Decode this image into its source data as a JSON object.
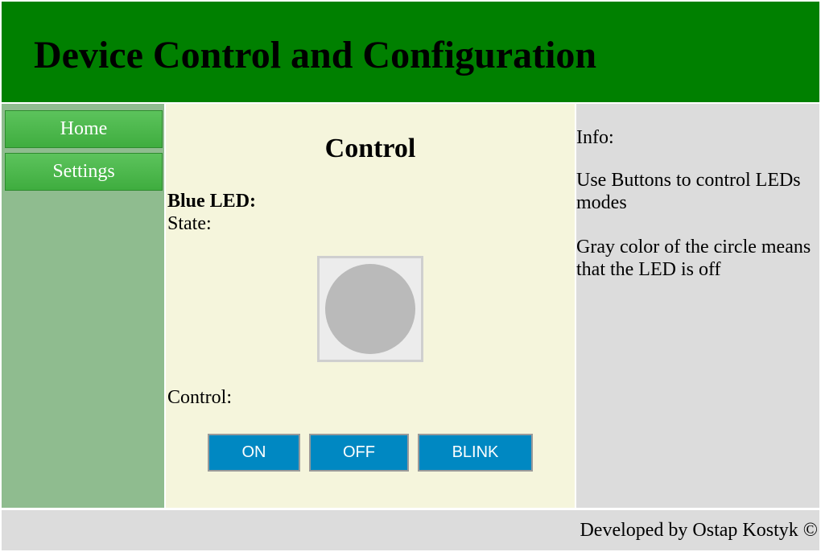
{
  "header": {
    "title": "Device Control and Configuration"
  },
  "colors": {
    "header_bg": "#008000",
    "sidebar_bg": "#8fbc8f",
    "main_bg": "#f5f5dc",
    "info_bg": "#dcdcdc",
    "button_bg": "#0088c2",
    "led_off": "#bababa"
  },
  "sidebar": {
    "items": [
      {
        "label": "Home"
      },
      {
        "label": "Settings"
      }
    ]
  },
  "main": {
    "title": "Control",
    "led_label": "Blue LED:",
    "state_label": "State:",
    "led_state_icon": "led-indicator-circle",
    "control_label": "Control:",
    "buttons": {
      "on": "ON",
      "off": "OFF",
      "blink": "BLINK"
    }
  },
  "info": {
    "title": "Info:",
    "text1": "Use Buttons to control LEDs modes",
    "text2": "Gray color of the circle means that the LED is off"
  },
  "footer": {
    "text": "Developed by Ostap Kostyk ©"
  }
}
